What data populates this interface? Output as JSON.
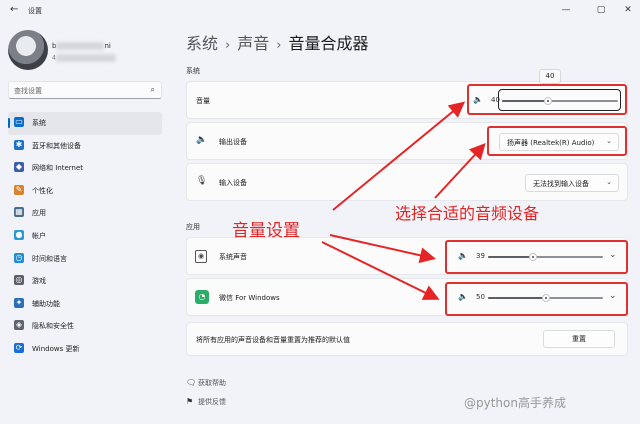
{
  "window": {
    "title": "设置",
    "back_icon": "back-arrow-icon"
  },
  "profile": {
    "name_visible": "b",
    "name_tail": "ni",
    "email_prefix": "4"
  },
  "search": {
    "placeholder": "查找设置",
    "icon": "search-icon"
  },
  "sidebar": {
    "items": [
      {
        "label": "系统",
        "icon": "system-icon",
        "color": "#0a6ec7",
        "active": true
      },
      {
        "label": "蓝牙和其他设备",
        "icon": "bluetooth-icon",
        "color": "#1a73c9"
      },
      {
        "label": "网络和 Internet",
        "icon": "network-icon",
        "color": "#3b5ea8"
      },
      {
        "label": "个性化",
        "icon": "personalization-icon",
        "color": "#d9822b"
      },
      {
        "label": "应用",
        "icon": "apps-icon",
        "color": "#4a6b8a"
      },
      {
        "label": "帐户",
        "icon": "account-icon",
        "color": "#2b9bd6"
      },
      {
        "label": "时间和语言",
        "icon": "time-language-icon",
        "color": "#1f8fd1"
      },
      {
        "label": "游戏",
        "icon": "gaming-icon",
        "color": "#5a5f69"
      },
      {
        "label": "辅助功能",
        "icon": "accessibility-icon",
        "color": "#2a6fb8"
      },
      {
        "label": "隐私和安全性",
        "icon": "privacy-shield-icon",
        "color": "#5d6470"
      },
      {
        "label": "Windows 更新",
        "icon": "windows-update-icon",
        "color": "#1a6ed0"
      }
    ]
  },
  "breadcrumb": {
    "items": [
      "系统",
      "声音"
    ],
    "current": "音量合成器",
    "separator": "›"
  },
  "system_section": {
    "label": "系统",
    "volume": {
      "label": "音量",
      "value_label": "40",
      "value": 40,
      "tooltip": "40"
    },
    "output": {
      "label": "输出设备",
      "selected": "扬声器 (Realtek(R) Audio)"
    },
    "input": {
      "label": "输入设备",
      "selected": "无法找到输入设备"
    }
  },
  "apps_section": {
    "label": "应用",
    "apps": [
      {
        "label": "系统声音",
        "value_label": "39",
        "value": 39,
        "icon": "speaker-device-icon"
      },
      {
        "label": "微信 For Windows",
        "value_label": "50",
        "value": 50,
        "icon": "wechat-icon",
        "color": "#2aae67"
      }
    ],
    "reset": {
      "label": "将所有应用的声音设备和音量重置为推荐的默认值",
      "button": "重置"
    }
  },
  "footer": {
    "help": "获取帮助",
    "feedback": "提供反馈"
  },
  "annotations": {
    "volume_settings": "音量设置",
    "select_device": "选择合适的音频设备",
    "color": "#e52525"
  },
  "watermark": "@python高手养成"
}
